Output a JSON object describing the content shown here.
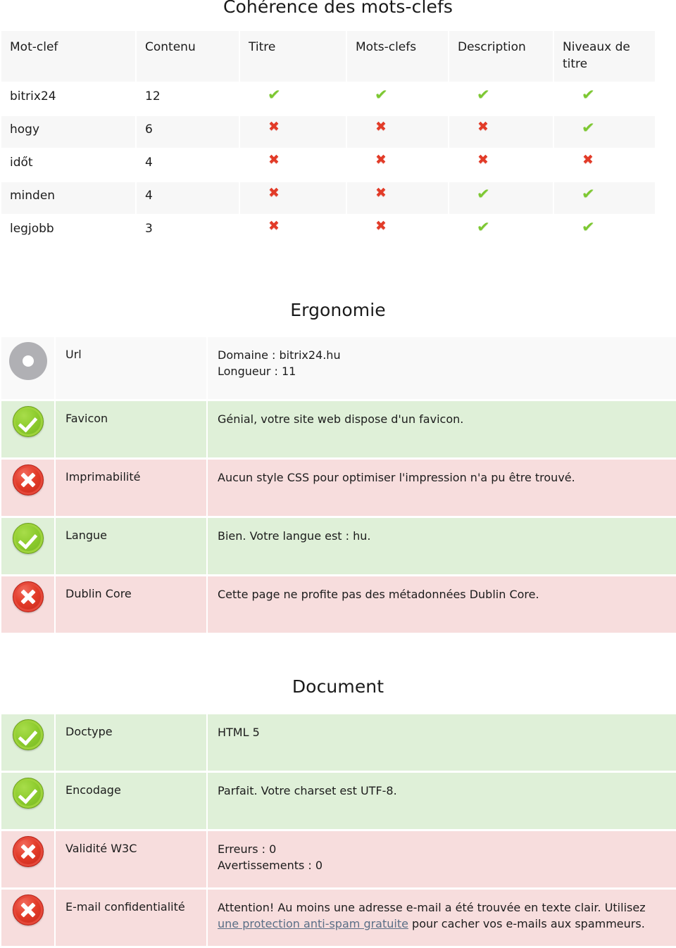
{
  "sections": {
    "keywords": {
      "title": "Cohérence des mots-clefs",
      "columns": [
        "Mot-clef",
        "Contenu",
        "Titre",
        "Mots-clefs",
        "Description",
        "Niveaux de titre"
      ],
      "rows": [
        {
          "keyword": "bitrix24",
          "content": "12",
          "titre": "ok",
          "motsclefs": "ok",
          "description": "ok",
          "niveaux": "ok"
        },
        {
          "keyword": "hogy",
          "content": "6",
          "titre": "bad",
          "motsclefs": "bad",
          "description": "bad",
          "niveaux": "ok"
        },
        {
          "keyword": "időt",
          "content": "4",
          "titre": "bad",
          "motsclefs": "bad",
          "description": "bad",
          "niveaux": "bad"
        },
        {
          "keyword": "minden",
          "content": "4",
          "titre": "bad",
          "motsclefs": "bad",
          "description": "ok",
          "niveaux": "ok"
        },
        {
          "keyword": "legjobb",
          "content": "3",
          "titre": "bad",
          "motsclefs": "bad",
          "description": "ok",
          "niveaux": "ok"
        }
      ]
    },
    "ergonomie": {
      "title": "Ergonomie",
      "rows": [
        {
          "status": "info",
          "label": "Url",
          "line1": "Domaine : bitrix24.hu",
          "line2": "Longueur : 11"
        },
        {
          "status": "ok",
          "label": "Favicon",
          "line1": "Génial, votre site web dispose d'un favicon.",
          "line2": ""
        },
        {
          "status": "bad",
          "label": "Imprimabilité",
          "line1": "Aucun style CSS pour optimiser l'impression n'a pu être trouvé.",
          "line2": ""
        },
        {
          "status": "ok",
          "label": "Langue",
          "line1": "Bien. Votre langue est : hu.",
          "line2": ""
        },
        {
          "status": "bad",
          "label": "Dublin Core",
          "line1": "Cette page ne profite pas des métadonnées Dublin Core.",
          "line2": ""
        }
      ]
    },
    "document": {
      "title": "Document",
      "rows": [
        {
          "status": "ok",
          "label": "Doctype",
          "line1": "HTML 5",
          "line2": ""
        },
        {
          "status": "ok",
          "label": "Encodage",
          "line1": "Parfait. Votre charset est UTF-8.",
          "line2": ""
        },
        {
          "status": "bad",
          "label": "Validité W3C",
          "line1": "Erreurs : 0",
          "line2": "Avertissements : 0"
        }
      ],
      "email_row": {
        "status": "bad",
        "label": "E-mail confidentialité",
        "text_before": "Attention! Au moins une adresse e-mail a été trouvée en texte clair. Utilisez ",
        "link_text": "une protection anti-spam gratuite",
        "text_after": " pour cacher vos e-mails aux spammeurs."
      }
    }
  },
  "icons": {
    "check_glyph": "✔",
    "cross_glyph": "✖",
    "ok_badge": "green-check-circle-icon",
    "bad_badge": "red-cross-circle-icon",
    "info_badge": "grey-disc-icon"
  },
  "colors": {
    "ok_row_bg": "#dff0d8",
    "bad_row_bg": "#f7dddd",
    "info_row_bg": "#f9f9f9",
    "check_green": "#7dc832",
    "cross_red": "#e23b28",
    "link": "#5a6e86"
  }
}
